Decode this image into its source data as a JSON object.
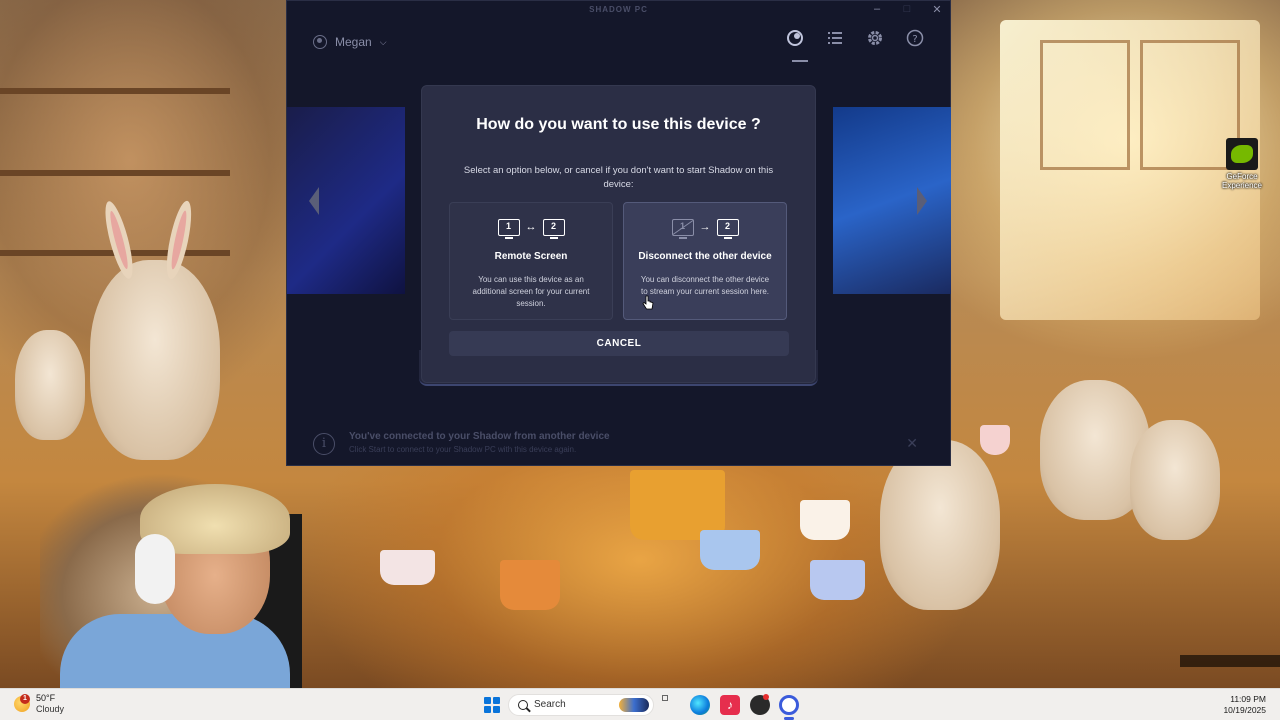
{
  "app": {
    "window_title": "SHADOW PC",
    "user_name": "Megan"
  },
  "header_icons": [
    "shadow-logo-icon",
    "list-icon",
    "gear-icon",
    "help-icon"
  ],
  "modal": {
    "title": "How do you want to use this device ?",
    "description": "Select an option below, or cancel if you don't want to start Shadow on this device:",
    "options": [
      {
        "title": "Remote Screen",
        "text": "You can use this device as an additional screen for your current session.",
        "monitor_a": "1",
        "monitor_b": "2",
        "link_symbol": "↔"
      },
      {
        "title": "Disconnect the other device",
        "text": "You can disconnect the other device to stream your current session here.",
        "monitor_a": "1",
        "monitor_b": "2",
        "link_symbol": "→"
      }
    ],
    "cancel_label": "CANCEL"
  },
  "info_bar": {
    "title": "You've connected to your Shadow from another device",
    "subtitle": "Click Start to connect to your Shadow PC with this device again."
  },
  "desktop": {
    "icon_label": "GeForce Experience"
  },
  "taskbar": {
    "weather_badge": "1",
    "temperature": "50°F",
    "condition": "Cloudy",
    "search_placeholder": "Search",
    "time": "11:09 PM",
    "date": "10/19/2025"
  },
  "colors": {
    "modal_bg": "#2b2e45",
    "window_bg": "#14172a",
    "accent": "#3b5bdb"
  }
}
